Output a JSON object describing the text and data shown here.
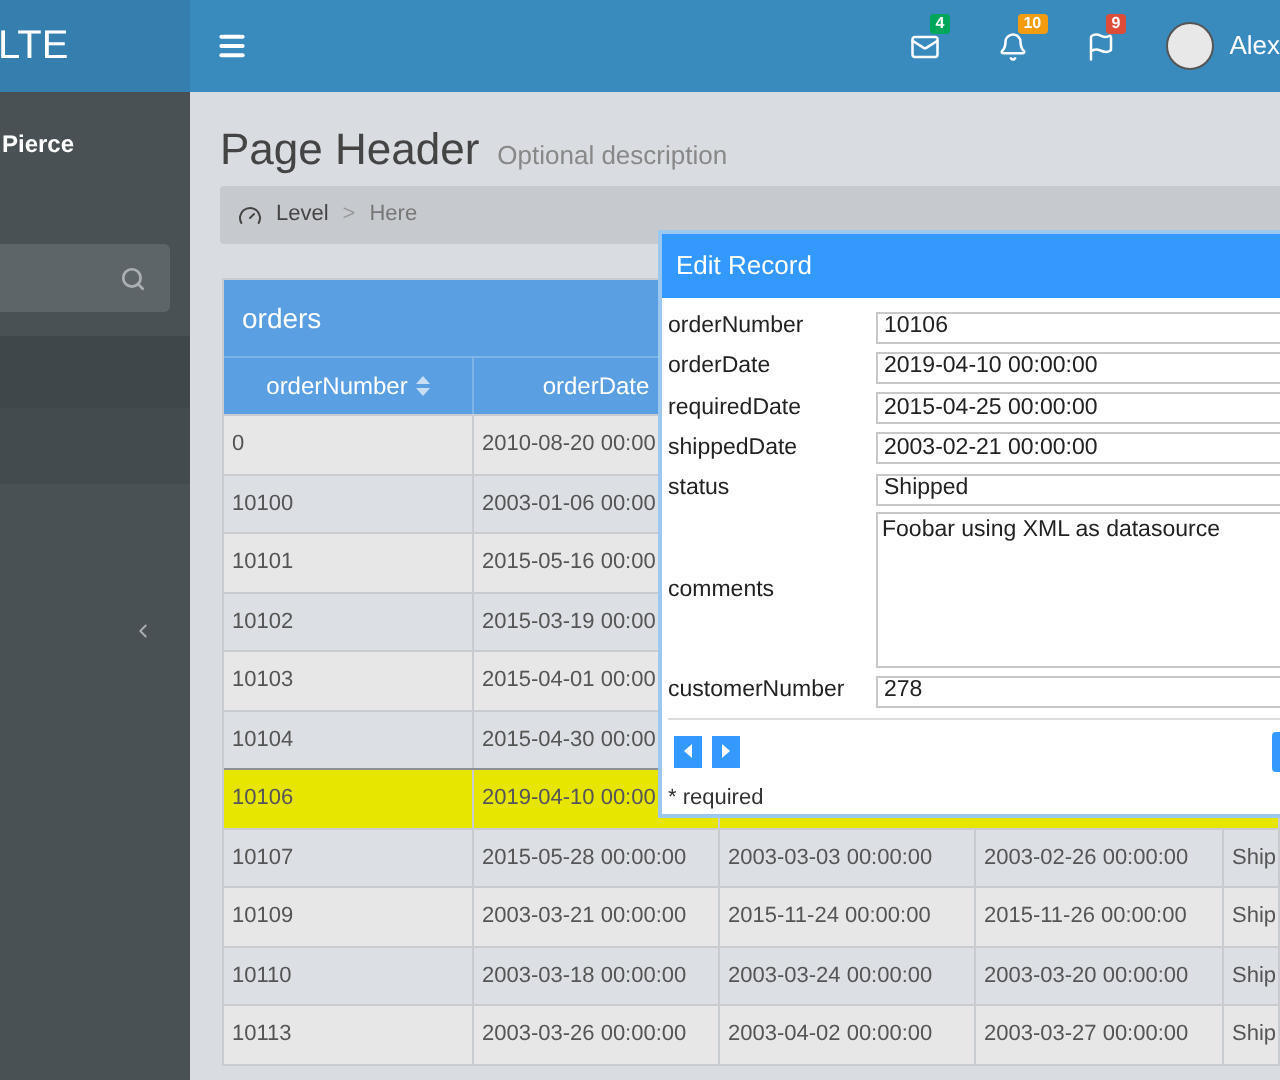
{
  "logo": "LTE",
  "navbar": {
    "notifications": [
      {
        "kind": "mail",
        "count": "4",
        "color": "#00a65a"
      },
      {
        "kind": "bell",
        "count": "10",
        "color": "#f39c12"
      },
      {
        "kind": "flag",
        "count": "9",
        "color": "#dd4b39"
      }
    ],
    "user_name": "Alex"
  },
  "sidebar": {
    "user_name": "Pierce"
  },
  "page": {
    "title": "Page Header",
    "description": "Optional description"
  },
  "breadcrumb": [
    {
      "label": "Level",
      "selected": false
    },
    {
      "label": "Here",
      "selected": true
    }
  ],
  "breadcrumb_separator": ">",
  "table": {
    "title": "orders",
    "columns": [
      {
        "label": "orderNumber",
        "sortable": true
      },
      {
        "label": "orderDate",
        "sortable": false
      }
    ],
    "rows": [
      {
        "cells": [
          "0",
          "2010-08-20 00:00"
        ],
        "selected": false
      },
      {
        "cells": [
          "10100",
          "2003-01-06 00:00"
        ],
        "selected": false
      },
      {
        "cells": [
          "10101",
          "2015-05-16 00:00"
        ],
        "selected": false
      },
      {
        "cells": [
          "10102",
          "2015-03-19 00:00"
        ],
        "selected": false
      },
      {
        "cells": [
          "10103",
          "2015-04-01 00:00"
        ],
        "selected": false
      },
      {
        "cells": [
          "10104",
          "2015-04-30 00:00"
        ],
        "selected": false
      },
      {
        "cells": [
          "10106",
          "2019-04-10 00:00"
        ],
        "selected": true
      },
      {
        "cells": [
          "10107",
          "2015-05-28 00:00:00",
          "2003-03-03 00:00:00",
          "2003-02-26 00:00:00",
          "Ship"
        ],
        "selected": false
      },
      {
        "cells": [
          "10109",
          "2003-03-21 00:00:00",
          "2015-11-24 00:00:00",
          "2015-11-26 00:00:00",
          "Ship"
        ],
        "selected": false
      },
      {
        "cells": [
          "10110",
          "2003-03-18 00:00:00",
          "2003-03-24 00:00:00",
          "2003-03-20 00:00:00",
          "Ship"
        ],
        "selected": false
      },
      {
        "cells": [
          "10113",
          "2003-03-26 00:00:00",
          "2003-04-02 00:00:00",
          "2003-03-27 00:00:00",
          "Ship"
        ],
        "selected": false
      }
    ]
  },
  "dialog": {
    "title": "Edit Record",
    "fields": [
      {
        "label": "orderNumber",
        "value": "10106",
        "kind": "text"
      },
      {
        "label": "orderDate",
        "value": "2019-04-10 00:00:00",
        "kind": "text"
      },
      {
        "label": "requiredDate",
        "value": "2015-04-25 00:00:00",
        "kind": "text"
      },
      {
        "label": "shippedDate",
        "value": "2003-02-21 00:00:00",
        "kind": "text"
      },
      {
        "label": "status",
        "value": "Shipped",
        "kind": "text"
      },
      {
        "label": "comments",
        "value": "Foobar using XML as datasource",
        "kind": "textarea"
      },
      {
        "label": "customerNumber",
        "value": "278",
        "kind": "text"
      }
    ],
    "note": "* required"
  }
}
